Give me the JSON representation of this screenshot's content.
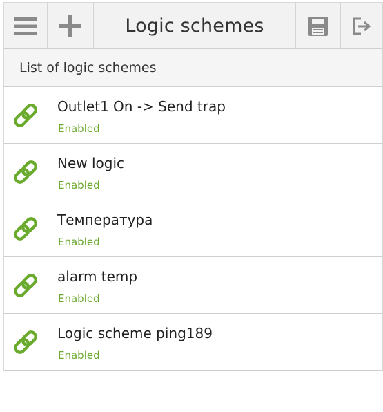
{
  "toolbar": {
    "title": "Logic schemes",
    "menu_icon": "hamburger-menu-icon",
    "add_icon": "plus-icon",
    "save_icon": "floppy-disk-icon",
    "exit_icon": "logout-icon"
  },
  "list_header": "List of logic schemes",
  "schemes": [
    {
      "name": "Outlet1 On -> Send trap",
      "status": "Enabled"
    },
    {
      "name": "New logic",
      "status": "Enabled"
    },
    {
      "name": "Температура",
      "status": "Enabled"
    },
    {
      "name": "alarm temp",
      "status": "Enabled"
    },
    {
      "name": "Logic scheme ping189",
      "status": "Enabled"
    }
  ],
  "colors": {
    "link_icon": "#6aaa2c",
    "status_text": "#6aa82e",
    "toolbar_icon": "#8a8a8a"
  }
}
